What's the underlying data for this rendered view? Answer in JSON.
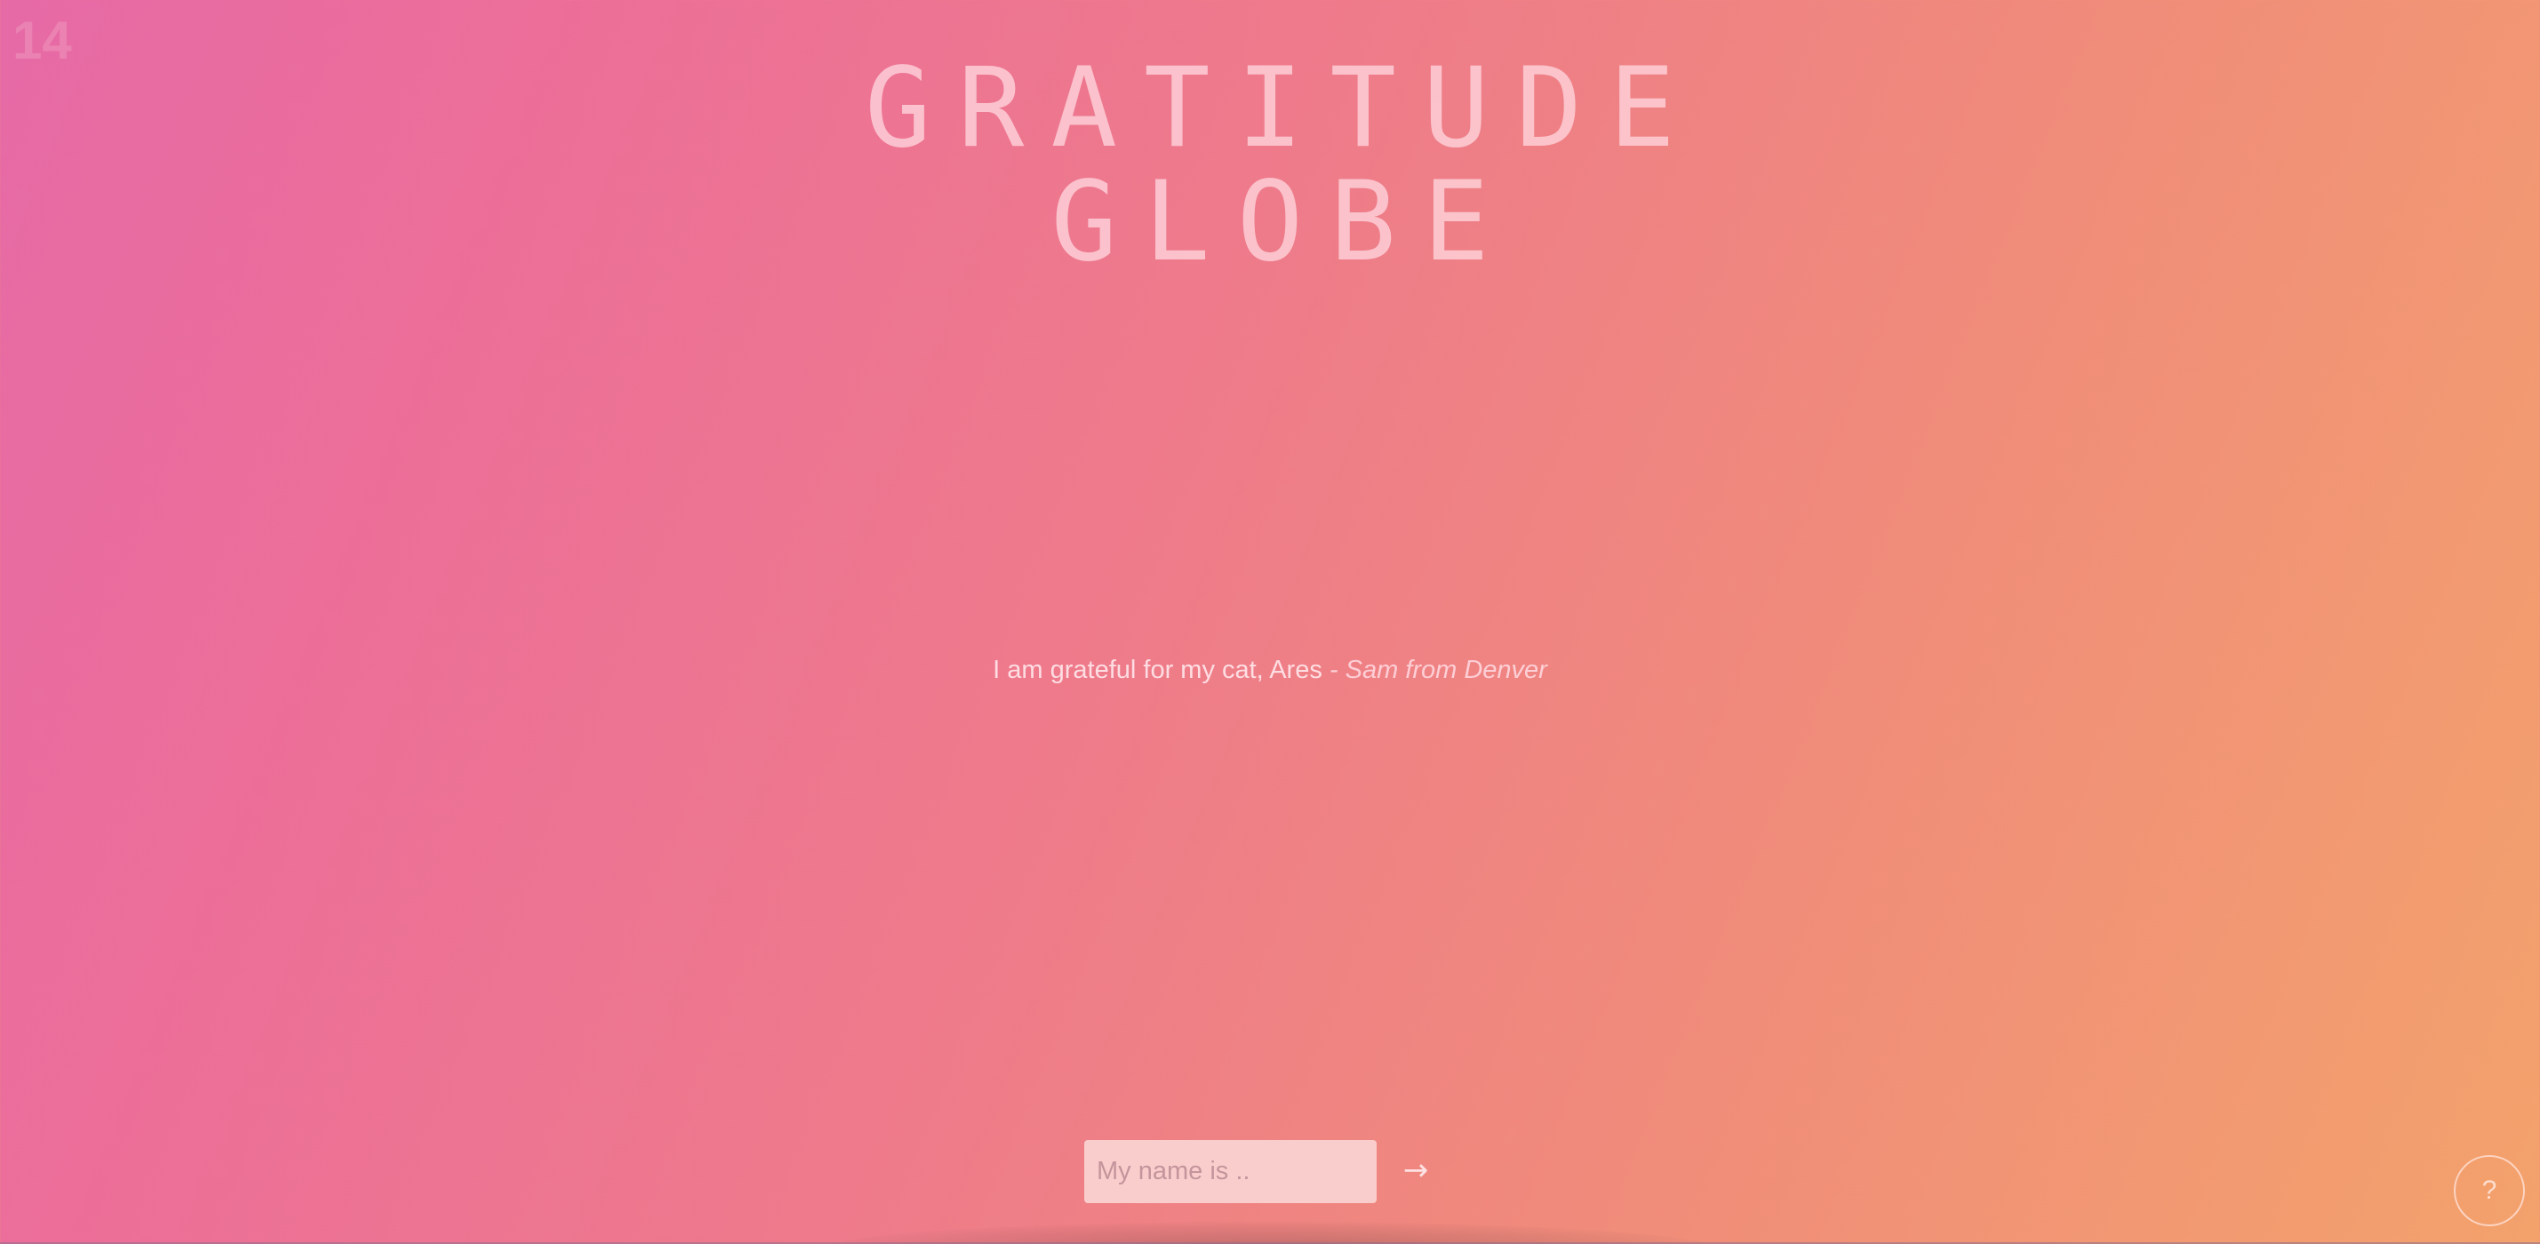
{
  "counter": "14",
  "title": {
    "line1": "GRATITUDE",
    "line2": "GLOBE"
  },
  "quote": {
    "text": "I am grateful for my cat, Ares",
    "author": "- Sam from Denver"
  },
  "form": {
    "name_placeholder": "My name is ..",
    "submit_glyph": "→"
  },
  "help": {
    "glyph": "?",
    "icon": "question-mark-icon"
  },
  "colors": {
    "gradient_start": "#e66aa6",
    "gradient_mid": "#ee7b8a",
    "gradient_end": "#f3a26c"
  }
}
